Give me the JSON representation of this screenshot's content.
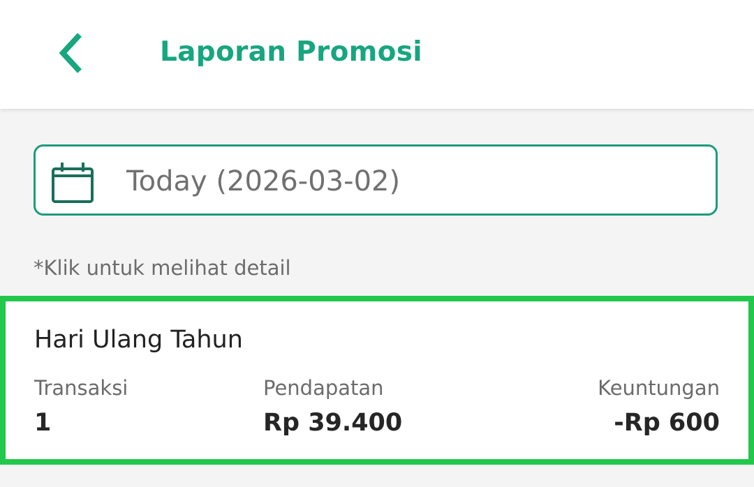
{
  "header": {
    "title": "Laporan Promosi",
    "back_icon": "chevron-left-icon"
  },
  "date_filter": {
    "icon": "calendar-icon",
    "value": "Today (2026-03-02)"
  },
  "hint": "*Klik untuk melihat detail",
  "promotions": [
    {
      "name": "Hari Ulang Tahun",
      "transaksi_label": "Transaksi",
      "transaksi_value": "1",
      "pendapatan_label": "Pendapatan",
      "pendapatan_value": "Rp 39.400",
      "keuntungan_label": "Keuntungan",
      "keuntungan_value": "-Rp 600"
    }
  ],
  "colors": {
    "brand": "#17a67f",
    "border": "#1f9a7d",
    "highlight": "#22c84c"
  }
}
